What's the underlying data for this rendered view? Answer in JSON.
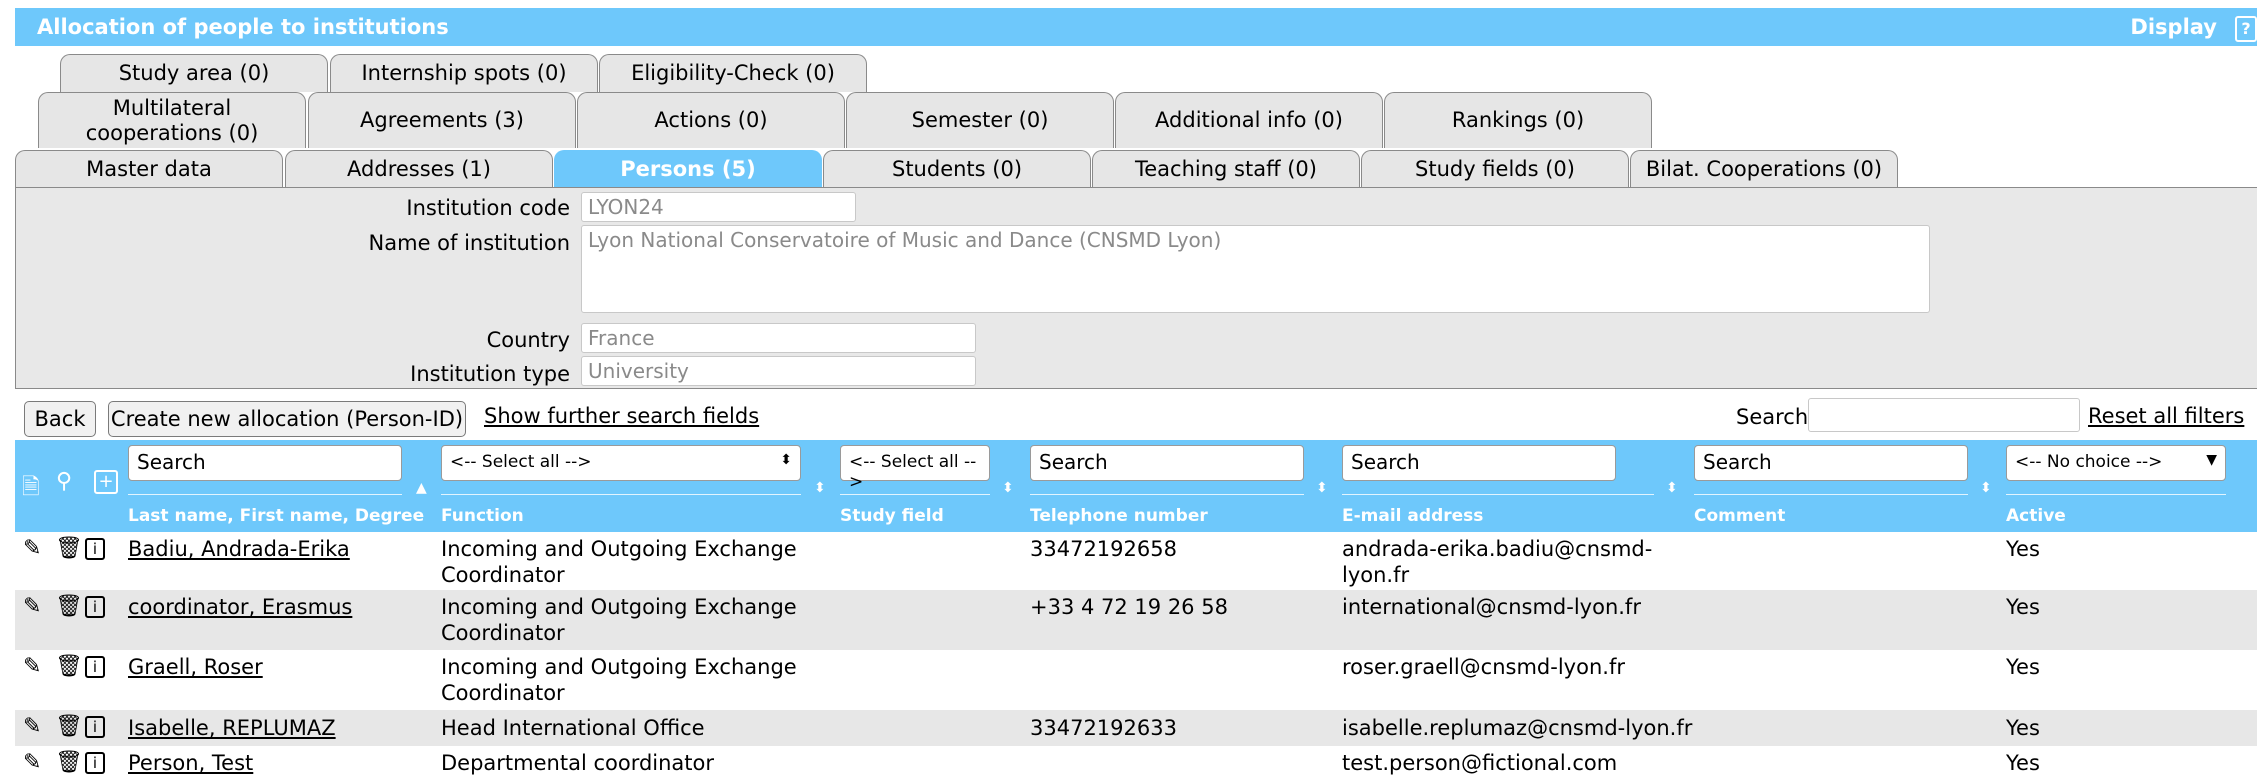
{
  "title": "Allocation of people to institutions",
  "display_label": "Display",
  "help_label": "?",
  "tabs_row1": [
    {
      "label": "Study area (0)"
    },
    {
      "label": "Internship spots (0)"
    },
    {
      "label": "Eligibility-Check (0)"
    }
  ],
  "tabs_row2": [
    {
      "label": "Multilateral cooperations (0)"
    },
    {
      "label": "Agreements (3)"
    },
    {
      "label": "Actions (0)"
    },
    {
      "label": "Semester (0)"
    },
    {
      "label": "Additional info (0)"
    },
    {
      "label": "Rankings (0)"
    }
  ],
  "tabs_row3": [
    {
      "label": "Master data"
    },
    {
      "label": "Addresses (1)"
    },
    {
      "label": "Persons (5)"
    },
    {
      "label": "Students (0)"
    },
    {
      "label": "Teaching staff (0)"
    },
    {
      "label": "Study fields (0)"
    },
    {
      "label": "Bilat. Cooperations (0)"
    }
  ],
  "fields": {
    "institution_code_label": "Institution code",
    "institution_code_value": "LYON24",
    "name_label": "Name of institution",
    "name_value": "Lyon National Conservatoire of Music and Dance (CNSMD Lyon)",
    "country_label": "Country",
    "country_value": "France",
    "type_label": "Institution type",
    "type_value": "University"
  },
  "toolbar": {
    "back": "Back",
    "create": "Create new allocation (Person-ID)",
    "show_further": "Show further search fields",
    "search_label": "Search",
    "reset": "Reset all filters"
  },
  "filters": {
    "name_placeholder": "Search",
    "function_select": "<-- Select all -->",
    "study_field_select": "<-- Select all -->",
    "phone_placeholder": "Search",
    "email_placeholder": "Search",
    "comment_placeholder": "Search",
    "active_select": "<-- No choice -->"
  },
  "columns": {
    "name": "Last name, First name, Degree",
    "function": "Function",
    "study_field": "Study field",
    "phone": "Telephone number",
    "email": "E-mail address",
    "comment": "Comment",
    "active": "Active"
  },
  "rows": [
    {
      "name": "Badiu, Andrada-Erika",
      "function": [
        "Incoming and Outgoing Exchange",
        "Coordinator"
      ],
      "phone": "33472192658",
      "email": [
        "andrada-erika.badiu@cnsmd-",
        "lyon.fr"
      ],
      "active": "Yes"
    },
    {
      "name": "coordinator, Erasmus",
      "function": [
        "Incoming and Outgoing Exchange",
        "Coordinator"
      ],
      "phone": "+33 4 72 19 26 58",
      "email": [
        "international@cnsmd-lyon.fr",
        ""
      ],
      "active": "Yes"
    },
    {
      "name": "Graell, Roser",
      "function": [
        "Incoming and Outgoing Exchange",
        "Coordinator"
      ],
      "phone": "",
      "email": [
        "roser.graell@cnsmd-lyon.fr",
        ""
      ],
      "active": "Yes"
    },
    {
      "name": "Isabelle, REPLUMAZ",
      "function": [
        "Head International Office",
        ""
      ],
      "phone": "33472192633",
      "email": [
        "isabelle.replumaz@cnsmd-lyon.fr",
        ""
      ],
      "active": "Yes"
    },
    {
      "name": "Person, Test",
      "function": [
        "Departmental coordinator",
        ""
      ],
      "phone": "",
      "email": [
        "test.person@fictional.com",
        ""
      ],
      "active": "Yes"
    }
  ]
}
